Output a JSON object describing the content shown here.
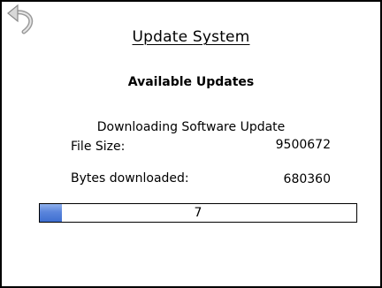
{
  "header": {
    "back_icon": "back-arrow-icon",
    "title": "Update System"
  },
  "main": {
    "heading": "Available Updates",
    "status": "Downloading Software Update",
    "file_size_label": "File Size:",
    "file_size_value": "9500672",
    "bytes_downloaded_label": "Bytes downloaded:",
    "bytes_downloaded_value": "680360",
    "progress": {
      "percent": 7,
      "label": "7",
      "fill_color": "#4f7bd6"
    }
  }
}
